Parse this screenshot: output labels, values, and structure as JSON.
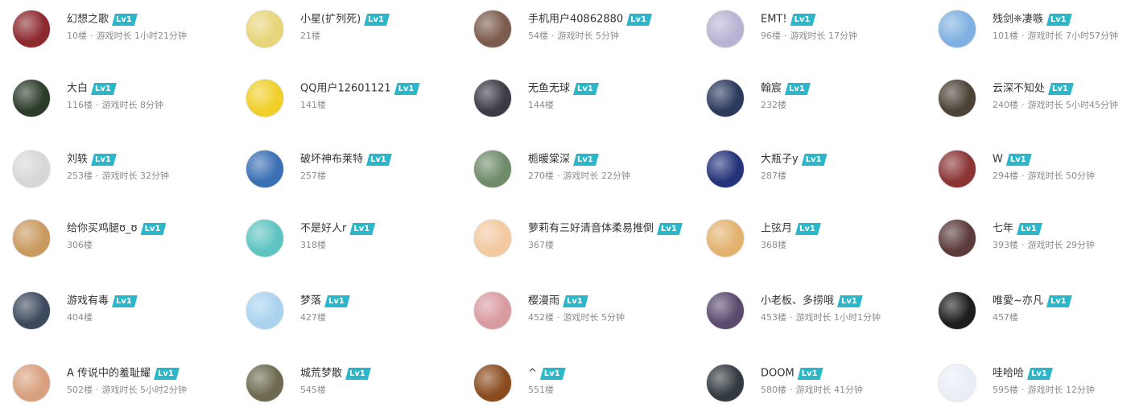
{
  "level_badge": "Lv1",
  "colors": {
    "accent": "#2bb7c9"
  },
  "players": [
    {
      "name": "幻想之歌",
      "floor": "10楼",
      "playtime_label": "游戏时长",
      "playtime": "1小时21分钟",
      "avatar_color": "#8c2a2f"
    },
    {
      "name": "小星(扩列死)",
      "floor": "21楼",
      "playtime_label": "",
      "playtime": "",
      "avatar_color": "#e7d57a"
    },
    {
      "name": "手机用户40862880",
      "floor": "54楼",
      "playtime_label": "游戏时长",
      "playtime": "5分钟",
      "avatar_color": "#7b5b4c"
    },
    {
      "name": "EMT!",
      "floor": "96楼",
      "playtime_label": "游戏时长",
      "playtime": "17分钟",
      "avatar_color": "#b9b3d3"
    },
    {
      "name": "残剑❈凄嗾",
      "floor": "101楼",
      "playtime_label": "游戏时长",
      "playtime": "7小时57分钟",
      "avatar_color": "#7fb0e1"
    },
    {
      "name": "大白",
      "floor": "116楼",
      "playtime_label": "游戏时长",
      "playtime": "8分钟",
      "avatar_color": "#2c3b2a"
    },
    {
      "name": "QQ用户12601121",
      "floor": "141楼",
      "playtime_label": "",
      "playtime": "",
      "avatar_color": "#f0cf2a"
    },
    {
      "name": "无鱼无球",
      "floor": "144楼",
      "playtime_label": "",
      "playtime": "",
      "avatar_color": "#3b3b45"
    },
    {
      "name": "翰宸",
      "floor": "232楼",
      "playtime_label": "",
      "playtime": "",
      "avatar_color": "#2b3a5c"
    },
    {
      "name": "云深不知处",
      "floor": "240楼",
      "playtime_label": "游戏时长",
      "playtime": "5小时45分钟",
      "avatar_color": "#4c4336"
    },
    {
      "name": "刘轶",
      "floor": "253楼",
      "playtime_label": "游戏时长",
      "playtime": "32分钟",
      "avatar_color": "#d7d7d7"
    },
    {
      "name": "破坏神布莱特",
      "floor": "257楼",
      "playtime_label": "",
      "playtime": "",
      "avatar_color": "#3a6fb4"
    },
    {
      "name": "栀暖棠深",
      "floor": "270楼",
      "playtime_label": "游戏时长",
      "playtime": "22分钟",
      "avatar_color": "#6f8b6a"
    },
    {
      "name": "大瓶子y",
      "floor": "287楼",
      "playtime_label": "",
      "playtime": "",
      "avatar_color": "#24337a"
    },
    {
      "name": "W",
      "floor": "294楼",
      "playtime_label": "游戏时长",
      "playtime": "50分钟",
      "avatar_color": "#8a3434"
    },
    {
      "name": "给你买鸡腿ʊ_ʊ",
      "floor": "306楼",
      "playtime_label": "",
      "playtime": "",
      "avatar_color": "#c99a5f"
    },
    {
      "name": "不是好人r",
      "floor": "318楼",
      "playtime_label": "",
      "playtime": "",
      "avatar_color": "#5ec4c1"
    },
    {
      "name": "萝莉有三好清音体柔易推倒",
      "floor": "367楼",
      "playtime_label": "",
      "playtime": "",
      "avatar_color": "#f2c9a0"
    },
    {
      "name": "上弦月",
      "floor": "368楼",
      "playtime_label": "",
      "playtime": "",
      "avatar_color": "#e3b26f"
    },
    {
      "name": "七年",
      "floor": "393楼",
      "playtime_label": "游戏时长",
      "playtime": "29分钟",
      "avatar_color": "#5b3a3a"
    },
    {
      "name": "游戏有毒",
      "floor": "404楼",
      "playtime_label": "",
      "playtime": "",
      "avatar_color": "#3d4a5e"
    },
    {
      "name": "梦落",
      "floor": "427楼",
      "playtime_label": "",
      "playtime": "",
      "avatar_color": "#a9d3ef"
    },
    {
      "name": "樱漫雨",
      "floor": "452楼",
      "playtime_label": "游戏时长",
      "playtime": "5分钟",
      "avatar_color": "#d99aa0"
    },
    {
      "name": "小老板、多捞哦",
      "floor": "453楼",
      "playtime_label": "游戏时长",
      "playtime": "1小时1分钟",
      "avatar_color": "#5a4a6e"
    },
    {
      "name": "唯愛~亦凡",
      "floor": "457楼",
      "playtime_label": "",
      "playtime": "",
      "avatar_color": "#1d1d1d"
    },
    {
      "name": "A 传说中的羞耻耀",
      "floor": "502楼",
      "playtime_label": "游戏时长",
      "playtime": "5小时2分钟",
      "avatar_color": "#d8a07e"
    },
    {
      "name": "城荒梦散",
      "floor": "545楼",
      "playtime_label": "",
      "playtime": "",
      "avatar_color": "#6d6a4f"
    },
    {
      "name": "^",
      "floor": "551楼",
      "playtime_label": "",
      "playtime": "",
      "avatar_color": "#8a4b1f"
    },
    {
      "name": "DOOM",
      "floor": "580楼",
      "playtime_label": "游戏时长",
      "playtime": "41分钟",
      "avatar_color": "#333a40"
    },
    {
      "name": "哇哈哈",
      "floor": "595楼",
      "playtime_label": "游戏时长",
      "playtime": "12分钟",
      "avatar_color": "#e9eef6"
    }
  ]
}
